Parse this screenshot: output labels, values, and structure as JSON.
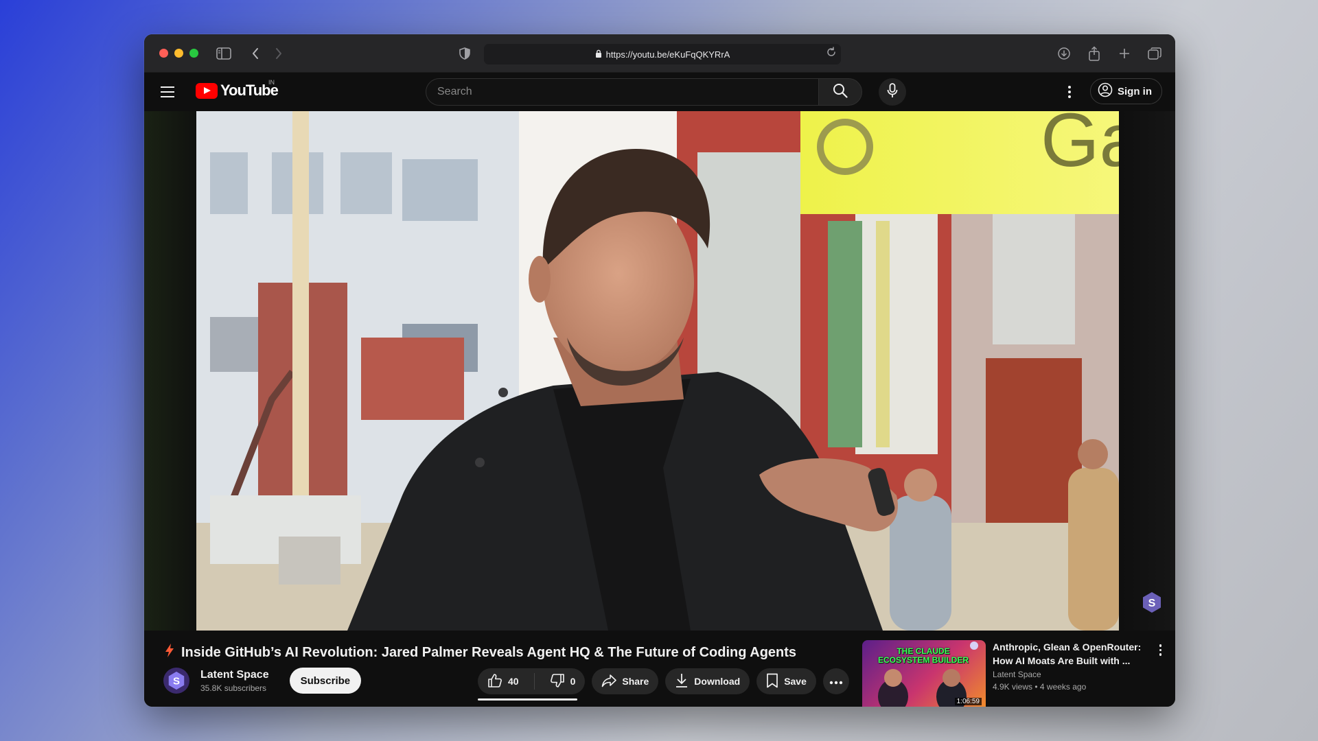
{
  "browser": {
    "url": "https://youtu.be/eKuFqQKYRrA"
  },
  "header": {
    "logo_text": "YouTube",
    "country_code": "IN",
    "search_placeholder": "Search",
    "sign_in_label": "Sign in"
  },
  "video": {
    "title": "Inside GitHub’s AI Revolution: Jared Palmer Reveals Agent HQ & The Future of Coding Agents",
    "background_sign_text": "Ga"
  },
  "channel": {
    "name": "Latent Space",
    "subscribers": "35.8K subscribers",
    "subscribe_label": "Subscribe"
  },
  "actions": {
    "like_count": "40",
    "dislike_count": "0",
    "share_label": "Share",
    "download_label": "Download",
    "save_label": "Save"
  },
  "suggested": {
    "thumbnail_text": "THE CLAUDE ECOSYSTEM BUILDER",
    "duration": "1:06:59",
    "title": "Anthropic, Glean & OpenRouter: How AI Moats Are Built with ...",
    "channel": "Latent Space",
    "meta": "4.9K views • 4 weeks ago"
  },
  "colors": {
    "youtube_red": "#ff0000",
    "accent_bolt": "#ff5a36",
    "background": "#0f0f0f"
  },
  "icons": [
    "sidebar-icon",
    "back-icon",
    "forward-icon",
    "shield-icon",
    "lock-icon",
    "reload-icon",
    "download-icon",
    "share-icon",
    "new-tab-icon",
    "tabs-icon",
    "menu-icon",
    "search-icon",
    "mic-icon",
    "more-icon",
    "account-icon",
    "like-icon",
    "dislike-icon",
    "save-icon"
  ]
}
